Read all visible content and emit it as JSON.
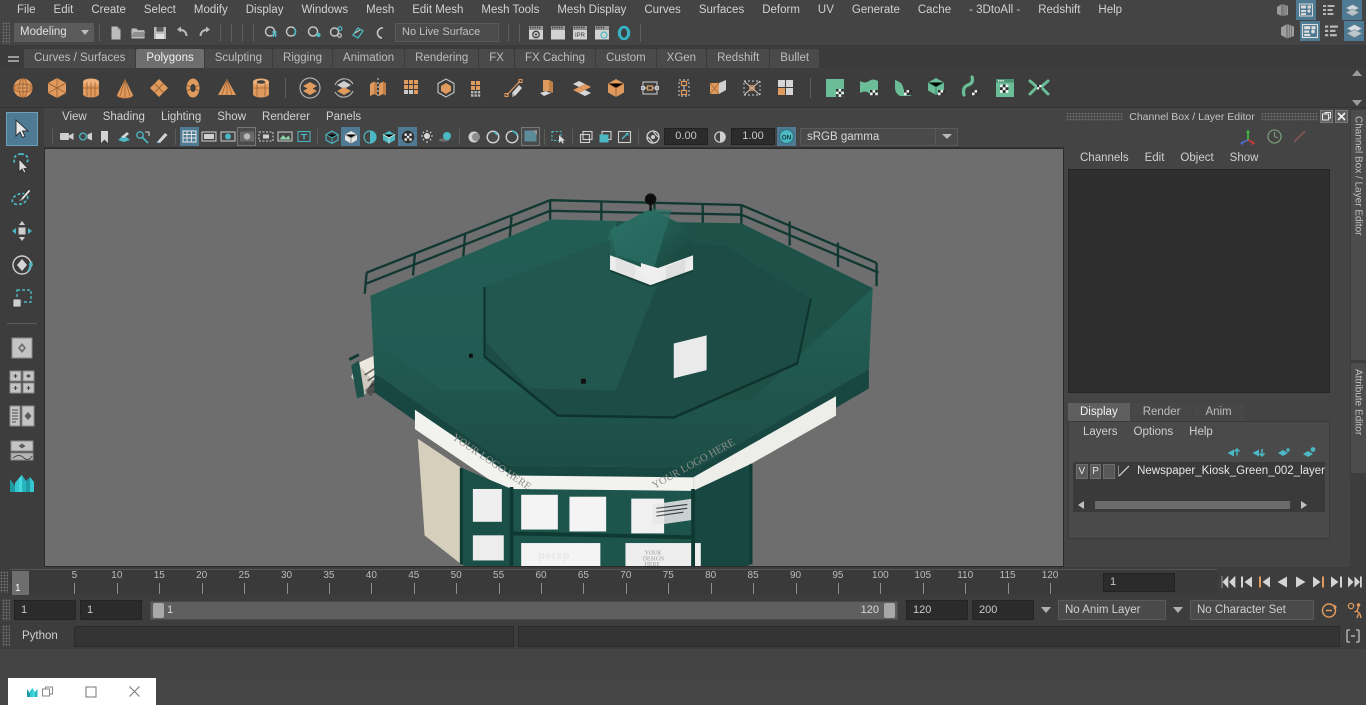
{
  "app": {
    "menus": [
      "File",
      "Edit",
      "Create",
      "Select",
      "Modify",
      "Display",
      "Windows",
      "Mesh",
      "Edit Mesh",
      "Mesh Tools",
      "Mesh Display",
      "Curves",
      "Surfaces",
      "Deform",
      "UV",
      "Generate",
      "Cache",
      "- 3DtoAll -",
      "Redshift",
      "Help"
    ]
  },
  "statusbar": {
    "menuset": "Modeling",
    "live_surface": "No Live Surface"
  },
  "shelf": {
    "tabs": [
      "Curves / Surfaces",
      "Polygons",
      "Sculpting",
      "Rigging",
      "Animation",
      "Rendering",
      "FX",
      "FX Caching",
      "Custom",
      "XGen",
      "Redshift",
      "Bullet"
    ],
    "active_tab": "Polygons",
    "icons": [
      {
        "name": "poly-sphere-icon"
      },
      {
        "name": "poly-cube-icon"
      },
      {
        "name": "poly-cylinder-icon"
      },
      {
        "name": "poly-cone-icon"
      },
      {
        "name": "poly-plane-icon"
      },
      {
        "name": "poly-torus-icon"
      },
      {
        "name": "poly-pyramid-icon"
      },
      {
        "name": "poly-pipe-icon"
      },
      {
        "name": "combine-icon"
      },
      {
        "name": "separate-icon"
      },
      {
        "name": "extract-icon"
      },
      {
        "name": "booleans-icon"
      },
      {
        "name": "smooth-icon"
      },
      {
        "name": "quad-draw-icon"
      },
      {
        "name": "multi-cut-icon"
      },
      {
        "name": "extrude-icon"
      },
      {
        "name": "bevel-icon"
      },
      {
        "name": "bridge-icon"
      },
      {
        "name": "append-icon"
      },
      {
        "name": "wedge-icon"
      },
      {
        "name": "poke-icon"
      },
      {
        "name": "connect-icon"
      },
      {
        "name": "merge-icon"
      },
      {
        "name": "uv-planar-icon"
      },
      {
        "name": "uv-cylindrical-icon"
      },
      {
        "name": "uv-spherical-icon"
      },
      {
        "name": "uv-automatic-icon"
      },
      {
        "name": "uv-contour-stretch-icon"
      },
      {
        "name": "uv-editor-icon"
      },
      {
        "name": "uv-unfold-icon"
      }
    ]
  },
  "tools": [
    {
      "name": "select-tool",
      "selected": true
    },
    {
      "name": "lasso-select-tool",
      "selected": false
    },
    {
      "name": "paint-select-tool",
      "selected": false
    },
    {
      "name": "move-tool",
      "selected": false
    },
    {
      "name": "rotate-tool",
      "selected": false
    },
    {
      "name": "scale-tool",
      "selected": false
    },
    {
      "name": "last-tool",
      "selected": false
    },
    {
      "name": "layout-single-icon",
      "selected": false
    },
    {
      "name": "layout-four-view-icon",
      "selected": false
    },
    {
      "name": "layout-outliner-persp-icon",
      "selected": false
    },
    {
      "name": "layout-persp-graph-icon",
      "selected": false
    },
    {
      "name": "maya-logo-icon",
      "selected": false
    }
  ],
  "viewport": {
    "menus": [
      "View",
      "Shading",
      "Lighting",
      "Show",
      "Renderer",
      "Panels"
    ],
    "exposure": "0.00",
    "gamma_value": "1.00",
    "color_management": "sRGB gamma",
    "camera_label": "persp",
    "model": {
      "description": "Octagonal green newspaper kiosk 3D model",
      "signage_top": "YOUR LOGO HERE",
      "signage_side": "YOUR LOGO HERE",
      "signage_lower": "YOUR DESIGN HERE"
    }
  },
  "right_panel": {
    "title": "Channel Box / Layer Editor",
    "channel_menus": [
      "Channels",
      "Edit",
      "Object",
      "Show"
    ],
    "layer_tabs": [
      "Display",
      "Render",
      "Anim"
    ],
    "active_layer_tab": "Display",
    "layer_menus": [
      "Layers",
      "Options",
      "Help"
    ],
    "layers": [
      {
        "visible": "V",
        "playback": "P",
        "color": "",
        "name": "Newspaper_Kiosk_Green_002_layer"
      }
    ],
    "vertical_tabs": [
      "Channel Box / Layer Editor",
      "Attribute Editor"
    ]
  },
  "timeline": {
    "ticks": [
      5,
      10,
      15,
      20,
      25,
      30,
      35,
      40,
      45,
      50,
      55,
      60,
      65,
      70,
      75,
      80,
      85,
      90,
      95,
      100,
      105,
      110,
      115,
      120
    ],
    "current_frame": "1",
    "frame_field": "1"
  },
  "range": {
    "start": "1",
    "playback_start": "1",
    "range_lo": "1",
    "range_hi": "120",
    "playback_end": "120",
    "end": "200",
    "anim_layer": "No Anim Layer",
    "character_set": "No Character Set"
  },
  "command_line": {
    "language": "Python",
    "input": "",
    "output": ""
  },
  "colors": {
    "accent_blue": "#4f7a93",
    "accent_teal": "#4bb8c4",
    "poly_orange": "#e09a5e",
    "uv_green": "#6bbd97",
    "panel_bg": "#444444",
    "viewport_bg": "#6e6e6e",
    "model_green": "#1d5149"
  }
}
